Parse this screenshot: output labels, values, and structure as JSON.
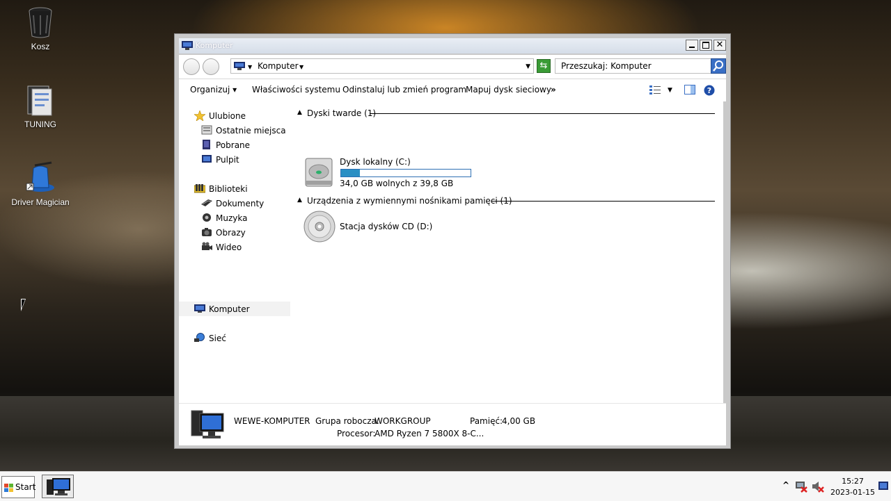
{
  "desktop": {
    "icons": [
      {
        "label": "Kosz"
      },
      {
        "label": "TUNING"
      },
      {
        "label": "Driver Magician"
      }
    ]
  },
  "window": {
    "title": "Komputer",
    "address": {
      "crumb": "Komputer"
    },
    "search": {
      "placeholder": "Przeszukaj: Komputer"
    },
    "toolbar": {
      "organize": "Organizuj",
      "system_properties": "Właściwości systemu",
      "uninstall": "Odinstaluj lub zmień program",
      "map_drive": "Mapuj dysk sieciowy",
      "more": "»"
    },
    "nav": {
      "favorites": "Ulubione",
      "recent": "Ostatnie miejsca",
      "downloads": "Pobrane",
      "desktop": "Pulpit",
      "libraries": "Biblioteki",
      "documents": "Dokumenty",
      "music": "Muzyka",
      "pictures": "Obrazy",
      "video": "Wideo",
      "computer": "Komputer",
      "network": "Sieć"
    },
    "groups": {
      "hard_disks": "Dyski twarde (1)",
      "removable": "Urządzenia z wymiennymi nośnikami pamięci (1)"
    },
    "drives": {
      "c": {
        "name": "Dysk lokalny (C:)",
        "free_text": "34,0 GB wolnych z 39,8 GB",
        "used_fraction": 0.146
      },
      "d": {
        "name": "Stacja dysków CD (D:)"
      }
    },
    "details": {
      "computer_name": "WEWE-KOMPUTER",
      "workgroup_label": "Grupa robocza:",
      "workgroup_value": "WORKGROUP",
      "memory_label": "Pamięć:",
      "memory_value": "4,00 GB",
      "processor_label": "Procesor:",
      "processor_value": "AMD Ryzen 7 5800X 8-C..."
    }
  },
  "taskbar": {
    "start_label": "Start",
    "clock_time": "15:27",
    "clock_date": "2023-01-15",
    "tray_expand": "^"
  },
  "colors": {
    "bar_fill": "#2a8fc4",
    "bar_border": "#2d6fb3",
    "accent_blue": "#3a6fc4"
  }
}
